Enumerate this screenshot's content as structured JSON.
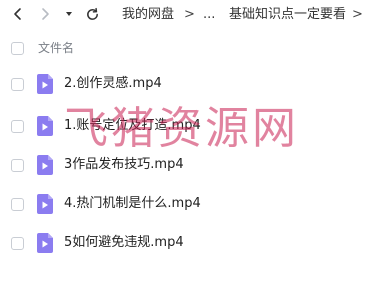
{
  "toolbar": {
    "back_icon": "chevron-left-icon",
    "forward_icon": "chevron-right-icon",
    "history_icon": "caret-down-icon",
    "refresh_icon": "refresh-icon"
  },
  "breadcrumb": {
    "home": "我的网盘",
    "separator": ">",
    "ellipsis": "...",
    "current": "基础知识点一定要看"
  },
  "list": {
    "header_label": "文件名",
    "files": [
      {
        "name": "2.创作灵感.mp4",
        "icon": "video-file-icon"
      },
      {
        "name": "1.账号定位及打造.mp4",
        "icon": "video-file-icon"
      },
      {
        "name": "3作品发布技巧.mp4",
        "icon": "video-file-icon"
      },
      {
        "name": "4.热门机制是什么.mp4",
        "icon": "video-file-icon"
      },
      {
        "name": "5如何避免违规.mp4",
        "icon": "video-file-icon"
      }
    ]
  },
  "watermark": {
    "text": "飞猪资源网"
  },
  "colors": {
    "file_icon": "#8b7cf0",
    "watermark": "#c81e50",
    "muted_text": "#7a7f87"
  }
}
